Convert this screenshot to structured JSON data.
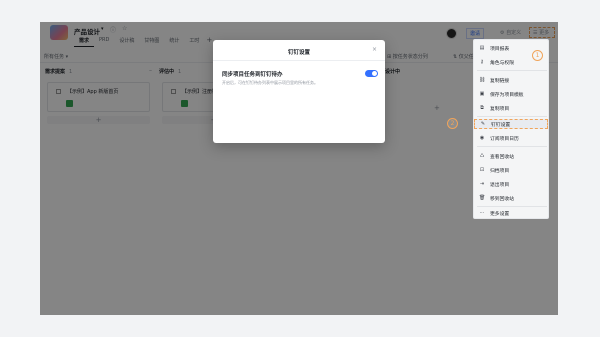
{
  "header": {
    "project_title": "产品设计",
    "tabs": [
      "需求",
      "PRD",
      "设计稿",
      "甘特图",
      "统计",
      "工时"
    ],
    "add_tab": "+",
    "share": "邀请",
    "customize": "自定义",
    "more": "更多"
  },
  "toolbar": {
    "all_tasks": "所有任务 ▾",
    "group_by_status": "按任务状态分列",
    "sort": "仅父任务"
  },
  "board": {
    "columns": [
      {
        "title": "需求提案",
        "count": "1"
      },
      {
        "title": "评估中",
        "count": "1"
      },
      {
        "title": "设计中",
        "count": ""
      }
    ],
    "cards": [
      {
        "text": "【示例】App 新版首页"
      },
      {
        "text": "【示例】注册链"
      }
    ],
    "add_label": "+"
  },
  "modal": {
    "title": "钉钉设置",
    "close": "×",
    "option_title": "同步项目任务到钉钉待办",
    "option_desc": "开启后，可在钉钉待办列表中展示项目里的所有任务。",
    "toggle_on": true
  },
  "menu": {
    "items": [
      {
        "icon": "▤",
        "icon_name": "project-report-icon",
        "label": "项目报表"
      },
      {
        "icon": "⚷",
        "icon_name": "role-permission-icon",
        "label": "角色与权限"
      },
      {
        "icon": "⛓",
        "icon_name": "copy-link-icon",
        "label": "复制链接"
      },
      {
        "icon": "▣",
        "icon_name": "save-template-icon",
        "label": "保存为项目模板"
      },
      {
        "icon": "⧉",
        "icon_name": "copy-project-icon",
        "label": "复制项目"
      },
      {
        "icon": "✎",
        "icon_name": "dingtalk-settings-icon",
        "label": "钉钉设置"
      },
      {
        "icon": "◉",
        "icon_name": "subscribe-calendar-icon",
        "label": "订阅项目日历"
      },
      {
        "icon": "♺",
        "icon_name": "recycle-bin-icon",
        "label": "查看回收站"
      },
      {
        "icon": "⊡",
        "icon_name": "archive-icon",
        "label": "归档项目"
      },
      {
        "icon": "⇥",
        "icon_name": "exit-project-icon",
        "label": "退出项目"
      },
      {
        "icon": "🗑",
        "icon_name": "move-to-trash-icon",
        "label": "移到回收站"
      },
      {
        "icon": "⋯",
        "icon_name": "more-settings-icon",
        "label": "更多设置"
      }
    ]
  },
  "badges": {
    "one": "1",
    "two": "2"
  }
}
